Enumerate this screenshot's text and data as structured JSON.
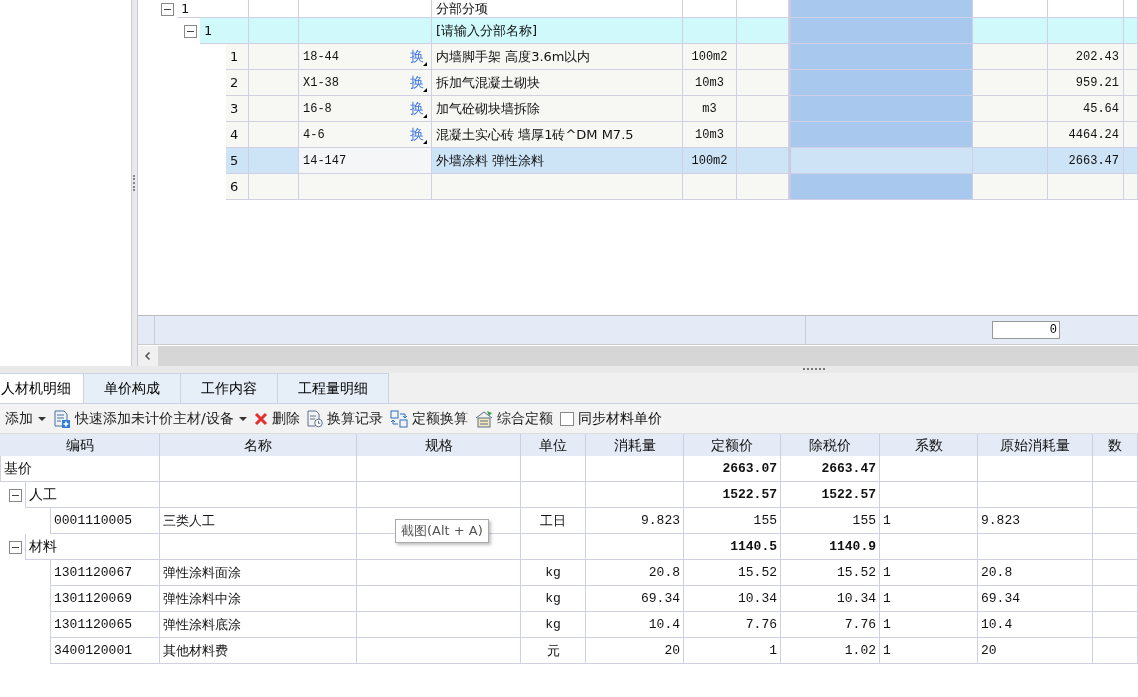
{
  "grid": {
    "rows": [
      {
        "kind": "group",
        "seq": "1",
        "name": "分部分项",
        "expanded": true,
        "children": [
          {
            "kind": "section",
            "seq": "1",
            "name": "[请输入分部名称]",
            "expanded": true,
            "children": [
              {
                "kind": "item",
                "seq": "1",
                "code": "18-44",
                "swap": "换",
                "name": "内墙脚手架 高度3.6m以内",
                "unit": "100m2",
                "price": "202.43",
                "selected": false
              },
              {
                "kind": "item",
                "seq": "2",
                "code": "X1-38",
                "swap": "换",
                "name": "拆加气混凝土砌块",
                "unit": "10m3",
                "price": "959.21",
                "selected": false
              },
              {
                "kind": "item",
                "seq": "3",
                "code": "16-8",
                "swap": "换",
                "name": "加气砼砌块墙拆除",
                "unit": "m3",
                "price": "45.64",
                "selected": false
              },
              {
                "kind": "item",
                "seq": "4",
                "code": "4-6",
                "swap": "换",
                "name": "混凝土实心砖 墙厚1砖^DM M7.5",
                "unit": "10m3",
                "price": "4464.24",
                "selected": false
              },
              {
                "kind": "item",
                "seq": "5",
                "code": "14-147",
                "name": "外墙涂料 弹性涂料",
                "unit": "100m2",
                "price": "2663.47",
                "selected": true
              },
              {
                "kind": "item",
                "seq": "6",
                "selected": false
              }
            ]
          }
        ]
      }
    ],
    "footer_value": "0"
  },
  "tabs": [
    {
      "label": "人材机明细",
      "selected": true
    },
    {
      "label": "单价构成",
      "selected": false
    },
    {
      "label": "工作内容",
      "selected": false
    },
    {
      "label": "工程量明细",
      "selected": false
    }
  ],
  "toolbar": [
    {
      "kind": "menu",
      "label": "添加"
    },
    {
      "kind": "add",
      "label": "快速添加未计价主材/设备"
    },
    {
      "kind": "delete",
      "label": "删除"
    },
    {
      "kind": "record",
      "label": "换算记录"
    },
    {
      "kind": "swap",
      "label": "定额换算"
    },
    {
      "kind": "composite",
      "label": "综合定额"
    },
    {
      "kind": "checkbox",
      "label": "同步材料单价",
      "checked": false
    }
  ],
  "detail": {
    "columns": [
      "编码",
      "名称",
      "规格",
      "单位",
      "消耗量",
      "定额价",
      "除税价",
      "系数",
      "原始消耗量",
      "数"
    ],
    "rows": [
      {
        "kind": "total",
        "code": "基价",
        "quota_price": "2663.07",
        "net_price": "2663.47"
      },
      {
        "kind": "category",
        "code": "人工",
        "expanded": true,
        "quota_price": "1522.57",
        "net_price": "1522.57",
        "children": [
          {
            "kind": "item",
            "code": "0001110005",
            "name": "三类人工",
            "unit": "工日",
            "consumption": "9.823",
            "quota_price": "155",
            "net_price": "155",
            "coefficient": "1",
            "original_consumption": "9.823"
          }
        ]
      },
      {
        "kind": "category",
        "code": "材料",
        "expanded": true,
        "quota_price": "1140.5",
        "net_price": "1140.9",
        "children": [
          {
            "kind": "item",
            "code": "1301120067",
            "name": "弹性涂料面涂",
            "unit": "kg",
            "consumption": "20.8",
            "quota_price": "15.52",
            "net_price": "15.52",
            "coefficient": "1",
            "original_consumption": "20.8"
          },
          {
            "kind": "item",
            "code": "1301120069",
            "name": "弹性涂料中涂",
            "unit": "kg",
            "consumption": "69.34",
            "quota_price": "10.34",
            "net_price": "10.34",
            "coefficient": "1",
            "original_consumption": "69.34"
          },
          {
            "kind": "item",
            "code": "1301120065",
            "name": "弹性涂料底涂",
            "unit": "kg",
            "consumption": "10.4",
            "quota_price": "7.76",
            "net_price": "7.76",
            "coefficient": "1",
            "original_consumption": "10.4"
          },
          {
            "kind": "item",
            "code": "3400120001",
            "name": "其他材料费",
            "unit": "元",
            "consumption": "20",
            "quota_price": "1",
            "net_price": "1.02",
            "coefficient": "1",
            "original_consumption": "20"
          }
        ]
      }
    ]
  },
  "tooltip": {
    "text": "截图(Alt + A)"
  }
}
